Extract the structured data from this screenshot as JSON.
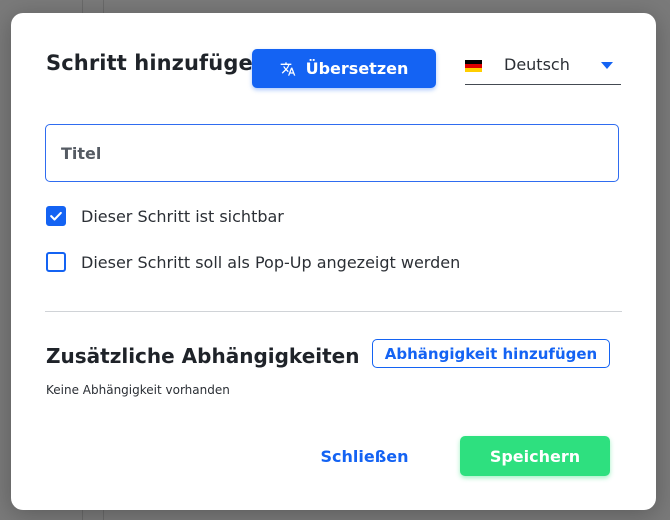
{
  "modal": {
    "title": "Schritt hinzufügen",
    "translate_button": {
      "label": "Übersetzen",
      "icon": "translate-icon"
    },
    "language_select": {
      "value": "Deutsch",
      "flag_icon": "germany-flag-icon",
      "flag_colors": [
        "#000000",
        "#dd0000",
        "#ffce00"
      ]
    },
    "title_input": {
      "placeholder": "Titel",
      "value": ""
    },
    "checkboxes": [
      {
        "label": "Dieser Schritt ist sichtbar",
        "checked": true
      },
      {
        "label": "Dieser Schritt soll als Pop-Up angezeigt werden",
        "checked": false
      }
    ],
    "dependencies": {
      "heading": "Zusätzliche Abhängigkeiten",
      "add_button": "Abhängigkeit hinzufügen",
      "empty_text": "Keine Abhängigkeit vorhanden"
    },
    "footer": {
      "close_label": "Schließen",
      "save_label": "Speichern"
    }
  },
  "colors": {
    "primary": "#1463f3",
    "success": "#2ee07f",
    "backdrop": "#7a7a7a"
  }
}
